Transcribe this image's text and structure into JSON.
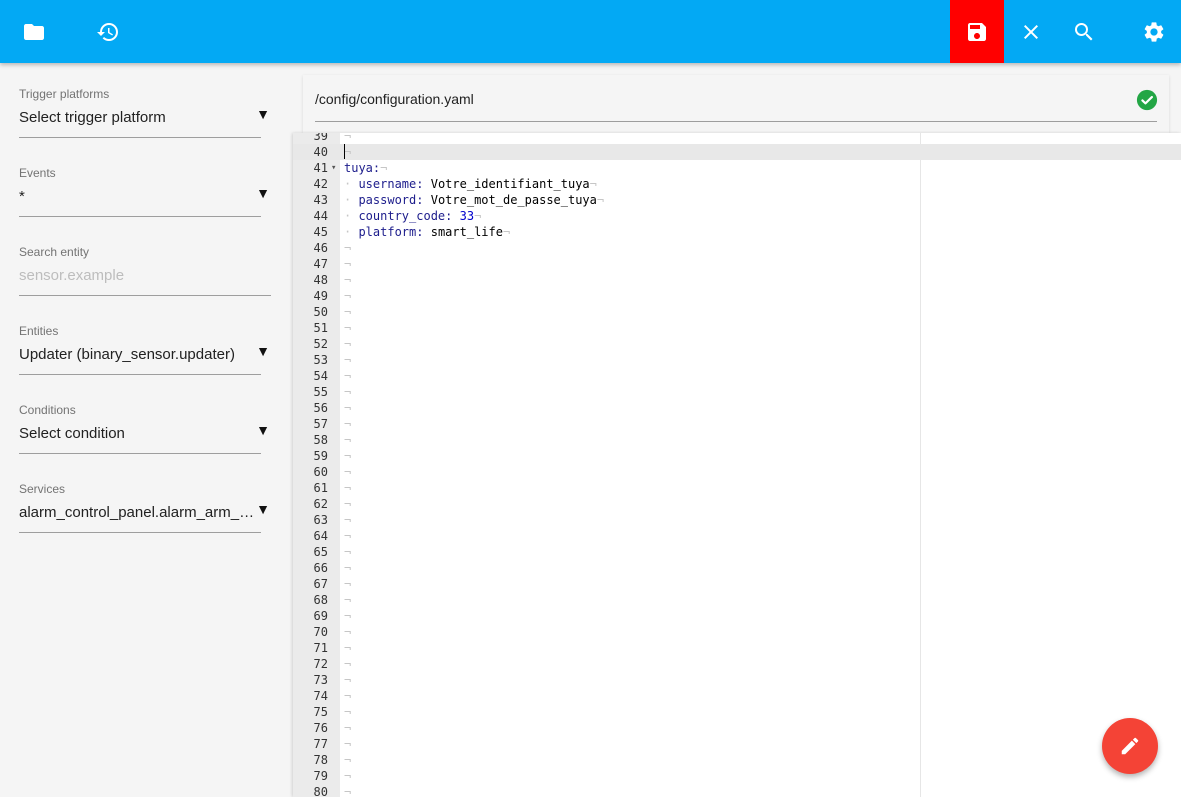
{
  "toolbar": {
    "icons": [
      "folder-icon",
      "history-icon",
      "save-icon",
      "close-icon",
      "search-icon",
      "gear-icon"
    ],
    "save_color": "#ff0000",
    "bar_color": "#03a9f4"
  },
  "sidebar": {
    "trigger_platforms": {
      "label": "Trigger platforms",
      "value": "Select trigger platform"
    },
    "events": {
      "label": "Events",
      "value": "*"
    },
    "search_entity": {
      "label": "Search entity",
      "placeholder": "sensor.example"
    },
    "entities": {
      "label": "Entities",
      "value": "Updater (binary_sensor.updater)"
    },
    "conditions": {
      "label": "Conditions",
      "value": "Select condition"
    },
    "services": {
      "label": "Services",
      "value": "alarm_control_panel.alarm_arm_away"
    }
  },
  "editor": {
    "file_path": "/config/configuration.yaml",
    "status_icon": "check-circle-icon",
    "status_color": "#23a645",
    "active_line": 40,
    "line_numbers": [
      "39",
      "40",
      "41",
      "42",
      "43",
      "44",
      "45",
      "46",
      "47",
      "48",
      "49",
      "50",
      "51",
      "52",
      "53",
      "54",
      "55",
      "56",
      "57",
      "58",
      "59",
      "60",
      "61",
      "62",
      "63",
      "64",
      "65",
      "66",
      "67",
      "68",
      "69",
      "70",
      "71",
      "72",
      "73",
      "74",
      "75",
      "76",
      "77",
      "78",
      "79",
      "80"
    ],
    "code": [
      {
        "key": "tuya",
        "value": "",
        "indent": 0
      },
      {
        "key": "username",
        "value": "Votre_identifiant_tuya",
        "indent": 1
      },
      {
        "key": "password",
        "value": "Votre_mot_de_passe_tuya",
        "indent": 1
      },
      {
        "key": "country_code",
        "value": "33",
        "indent": 1
      },
      {
        "key": "platform",
        "value": "smart_life",
        "indent": 1
      }
    ]
  },
  "fab": {
    "icon": "pencil-icon",
    "color": "#f44336"
  }
}
